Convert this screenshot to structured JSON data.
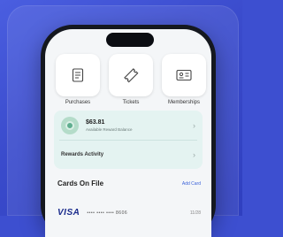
{
  "tiles": [
    {
      "label": "Purchases",
      "icon": "receipt-icon"
    },
    {
      "label": "Tickets",
      "icon": "ticket-icon"
    },
    {
      "label": "Memberships",
      "icon": "id-card-icon"
    }
  ],
  "rewards": {
    "balance": "$63.81",
    "balance_caption": "Available Reward Balance",
    "activity_label": "Rewards Activity"
  },
  "cards": {
    "title": "Cards On File",
    "add_label": "Add Card",
    "items": [
      {
        "brand": "VISA",
        "masked": "•••• •••• •••• 8606",
        "expiry": "11/28"
      }
    ]
  },
  "colors": {
    "background": "#3d4fd0",
    "rewards_bg": "#e4f3f1",
    "link": "#3b62d9"
  }
}
